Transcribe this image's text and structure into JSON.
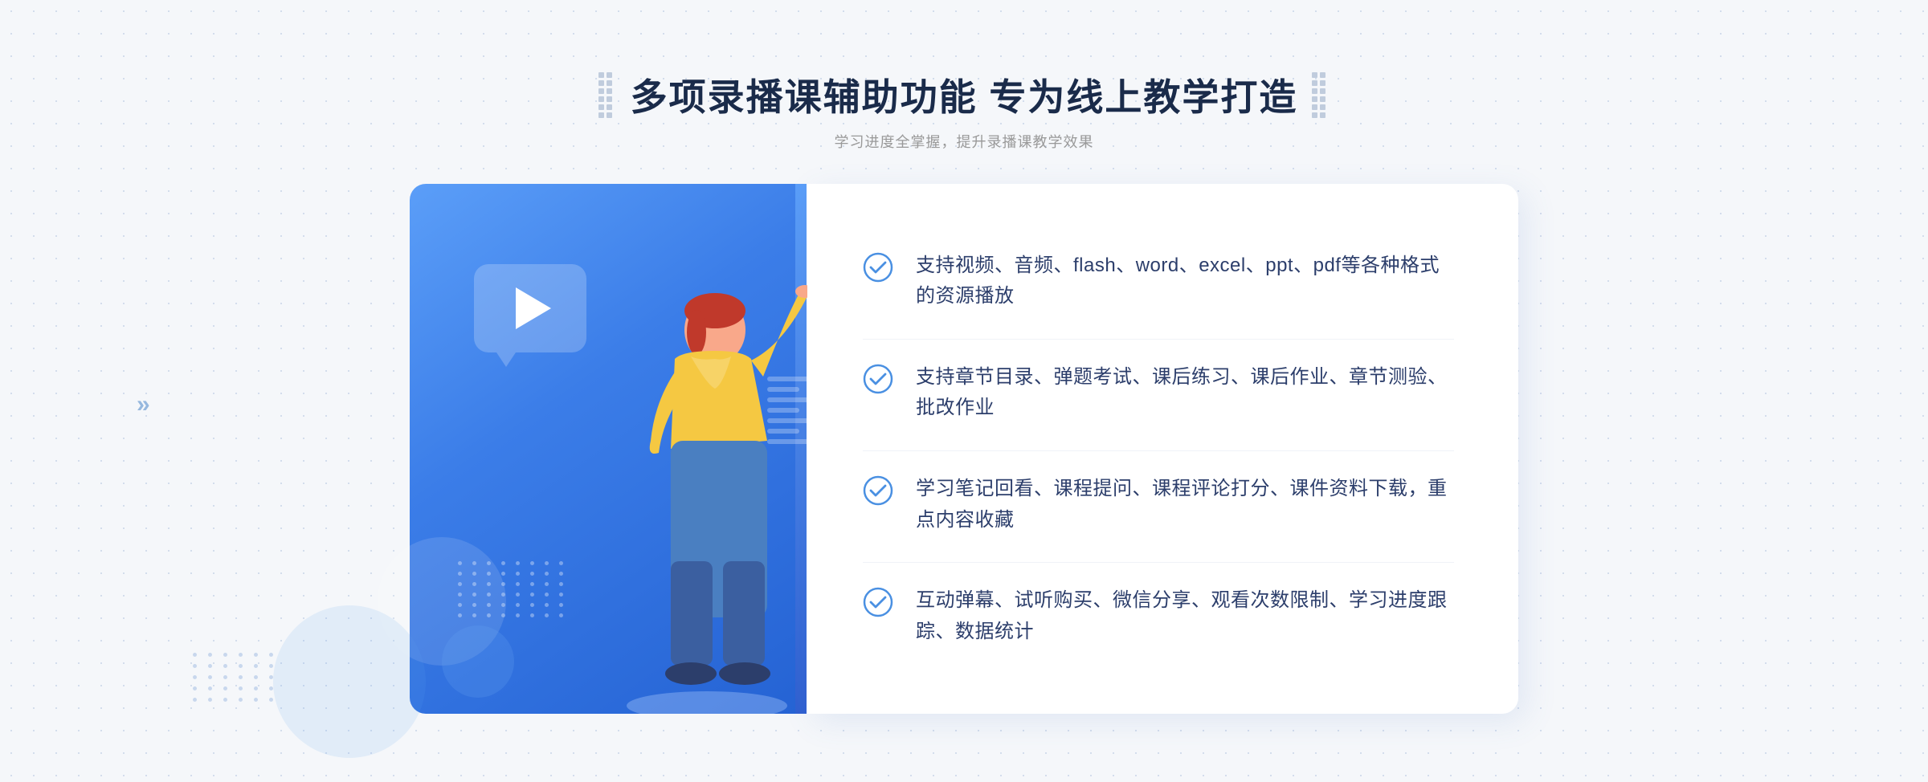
{
  "header": {
    "title": "多项录播课辅助功能 专为线上教学打造",
    "subtitle": "学习进度全掌握，提升录播课教学效果",
    "dots_left_label": "decorative-dots-left",
    "dots_right_label": "decorative-dots-right"
  },
  "features": [
    {
      "id": 1,
      "text": "支持视频、音频、flash、word、excel、ppt、pdf等各种格式的资源播放"
    },
    {
      "id": 2,
      "text": "支持章节目录、弹题考试、课后练习、课后作业、章节测验、批改作业"
    },
    {
      "id": 3,
      "text": "学习笔记回看、课程提问、课程评论打分、课件资料下载，重点内容收藏"
    },
    {
      "id": 4,
      "text": "互动弹幕、试听购买、微信分享、观看次数限制、学习进度跟踪、数据统计"
    }
  ],
  "colors": {
    "accent_blue": "#3b7de8",
    "light_blue": "#5b9ef8",
    "text_dark": "#1a2b4a",
    "text_medium": "#2c3e6b",
    "text_light": "#999999",
    "check_color": "#4a90e2",
    "white": "#ffffff"
  }
}
